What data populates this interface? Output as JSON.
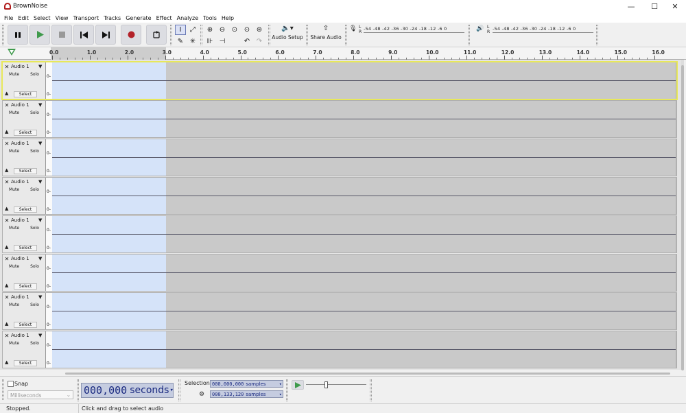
{
  "window": {
    "title": "BrownNoise",
    "minimize": "—",
    "maximize": "☐",
    "close": "✕"
  },
  "menu": [
    "File",
    "Edit",
    "Select",
    "View",
    "Transport",
    "Tracks",
    "Generate",
    "Effect",
    "Analyze",
    "Tools",
    "Help"
  ],
  "toolbar": {
    "audio_setup": "Audio Setup",
    "share_audio": "Share Audio",
    "record_meter_scale": "-54 -48 -42 -36 -30 -24 -18 -12 -6 0",
    "play_meter_scale": "-54 -48 -42 -36 -30 -24 -18 -12 -6 0",
    "lr": "L\nR"
  },
  "ruler": {
    "ticks": [
      "0.0",
      "1.0",
      "2.0",
      "3.0",
      "4.0",
      "5.0",
      "6.0",
      "7.0",
      "8.0",
      "9.0",
      "10.0",
      "11.0",
      "12.0",
      "13.0",
      "14.0",
      "15.0",
      "16.0"
    ]
  },
  "tracks": [
    {
      "name": "Audio 1",
      "mute": "Mute",
      "solo": "Solo",
      "select": "Select",
      "scale": "0-"
    },
    {
      "name": "Audio 1",
      "mute": "Mute",
      "solo": "Solo",
      "select": "Select",
      "scale": "0-"
    },
    {
      "name": "Audio 1",
      "mute": "Mute",
      "solo": "Solo",
      "select": "Select",
      "scale": "0-"
    },
    {
      "name": "Audio 1",
      "mute": "Mute",
      "solo": "Solo",
      "select": "Select",
      "scale": "0-"
    },
    {
      "name": "Audio 1",
      "mute": "Mute",
      "solo": "Solo",
      "select": "Select",
      "scale": "0-"
    },
    {
      "name": "Audio 1",
      "mute": "Mute",
      "solo": "Solo",
      "select": "Select",
      "scale": "0-"
    },
    {
      "name": "Audio 1",
      "mute": "Mute",
      "solo": "Solo",
      "select": "Select",
      "scale": "0-"
    },
    {
      "name": "Audio 1",
      "mute": "Mute",
      "solo": "Solo",
      "select": "Select",
      "scale": "0-"
    }
  ],
  "bottom": {
    "snap_label": "Snap",
    "snap_unit": "Milliseconds",
    "time_value": "000,000",
    "time_unit": "seconds",
    "selection_label": "Selection",
    "sel_start": "000,000,000",
    "sel_end": "000,133,120",
    "sel_unit": "samples"
  },
  "status": {
    "state": "Stopped.",
    "hint": "Click and drag to select audio"
  },
  "colors": {
    "record": "#b3222a",
    "play": "#3f9a4c",
    "selection": "#d5e3f9",
    "accent": "#e8e85a"
  }
}
